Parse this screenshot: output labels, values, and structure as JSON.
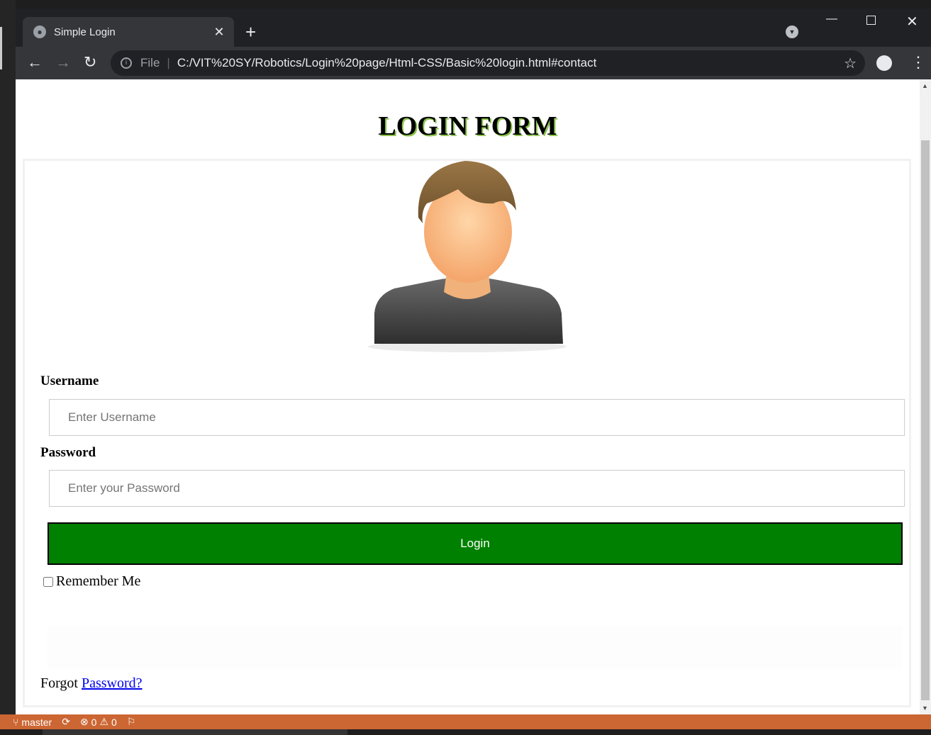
{
  "browser": {
    "tab_title": "Simple Login",
    "url_scheme_label": "File",
    "url": "C:/VIT%20SY/Robotics/Login%20page/Html-CSS/Basic%20login.html#contact"
  },
  "page": {
    "title": "LOGIN FORM",
    "username_label": "Username",
    "username_placeholder": "Enter Username",
    "password_label": "Password",
    "password_placeholder": "Enter your Password",
    "login_button": "Login",
    "remember_label": "Remember Me",
    "forgot_text": "Forgot",
    "forgot_link": "Password?"
  },
  "statusbar": {
    "branch": "master",
    "errors": "0",
    "warnings": "0"
  },
  "icons": [
    "globe-icon",
    "close-icon",
    "plus-icon",
    "tab-search-icon",
    "minimize-icon",
    "maximize-icon",
    "window-close-icon",
    "back-icon",
    "forward-icon",
    "reload-icon",
    "info-icon",
    "star-icon",
    "profile-icon",
    "menu-icon",
    "branch-icon",
    "sync-icon",
    "error-icon",
    "warning-icon",
    "broadcast-icon"
  ],
  "colors": {
    "login_button": "#008000",
    "statusbar": "#cc6633",
    "title_shadow": "#8bc34a"
  }
}
